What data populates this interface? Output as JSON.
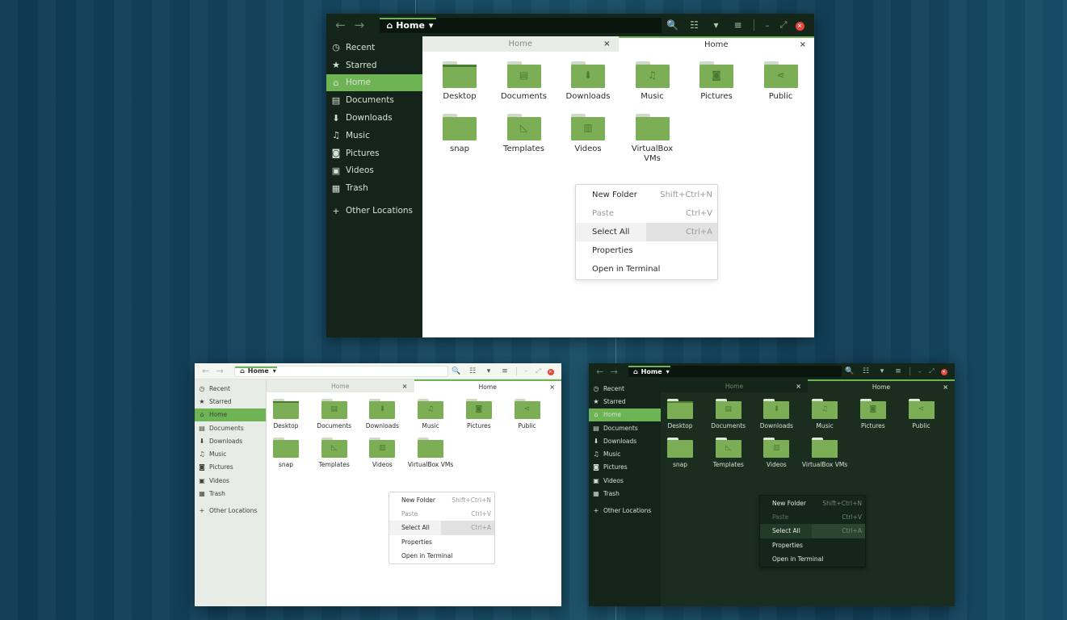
{
  "colors": {
    "accent": "#6fb454",
    "folder": "#7cae55",
    "dark_sidebar": "#14241a",
    "close_button": "#e8453c"
  },
  "path": {
    "label": "Home",
    "icon": "home-icon"
  },
  "toolbar": {
    "back_icon": "←",
    "forward_icon": "→",
    "search_icon": "🔍",
    "view_icon": "☷",
    "view_menu_icon": "▾",
    "menu_icon": "≡",
    "minimize_icon": "–",
    "maximize_icon": "⤢",
    "close_icon": "×"
  },
  "sidebar": {
    "items": [
      {
        "label": "Recent",
        "icon": "◷"
      },
      {
        "label": "Starred",
        "icon": "★"
      },
      {
        "label": "Home",
        "icon": "⌂"
      },
      {
        "label": "Documents",
        "icon": "▤"
      },
      {
        "label": "Downloads",
        "icon": "⬇"
      },
      {
        "label": "Music",
        "icon": "♫"
      },
      {
        "label": "Pictures",
        "icon": "◙"
      },
      {
        "label": "Videos",
        "icon": "▣"
      },
      {
        "label": "Trash",
        "icon": "▦"
      }
    ],
    "other": {
      "label": "Other Locations",
      "icon": "+"
    }
  },
  "tabs": [
    {
      "label": "Home",
      "close": "×"
    },
    {
      "label": "Home",
      "close": "×"
    }
  ],
  "folders": [
    {
      "label": "Desktop",
      "glyph": ""
    },
    {
      "label": "Documents",
      "glyph": "▤"
    },
    {
      "label": "Downloads",
      "glyph": "⬇"
    },
    {
      "label": "Music",
      "glyph": "♫"
    },
    {
      "label": "Pictures",
      "glyph": "◙"
    },
    {
      "label": "Public",
      "glyph": "⋖"
    },
    {
      "label": "snap",
      "glyph": ""
    },
    {
      "label": "Templates",
      "glyph": "◺"
    },
    {
      "label": "Videos",
      "glyph": "▥"
    },
    {
      "label": "VirtualBox VMs",
      "glyph": ""
    }
  ],
  "context_menu": [
    {
      "label": "New Folder",
      "shortcut": "Shift+Ctrl+N"
    },
    {
      "label": "Paste",
      "shortcut": "Ctrl+V"
    },
    {
      "label": "Select All",
      "shortcut": "Ctrl+A"
    },
    {
      "label": "Properties",
      "shortcut": ""
    },
    {
      "label": "Open in Terminal",
      "shortcut": ""
    }
  ]
}
